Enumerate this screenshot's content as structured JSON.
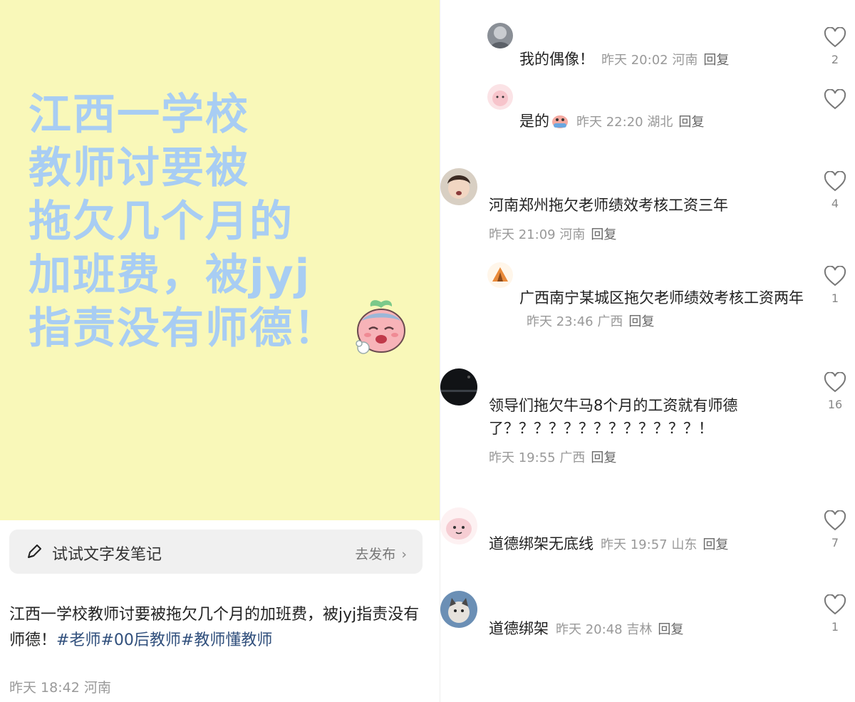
{
  "cover": {
    "lines": [
      "江西一学校",
      "教师讨要被",
      "拖欠几个月的",
      "加班费，被jyj",
      "指责没有师德！"
    ],
    "bg_color": "#f9f8b9",
    "text_color": "#a8cdf3"
  },
  "note_bar": {
    "prompt": "试试文字发笔记",
    "publish": "去发布",
    "icon": "pencil-icon"
  },
  "post": {
    "text": "江西一学校教师讨要被拖欠几个月的加班费，被jyj指责没有师德！",
    "tags": [
      "#老师",
      "#00后教师",
      "#教师懂教师"
    ],
    "meta": "昨天 18:42 河南"
  },
  "comments": [
    {
      "text": "我的偶像！",
      "meta": "昨天 20:02 河南",
      "reply": "回复",
      "likes": "2"
    },
    {
      "text": "是的",
      "meta": "昨天 22:20 湖北",
      "reply": "回复",
      "likes": ""
    },
    {
      "text": "河南郑州拖欠老师绩效考核工资三年",
      "meta": "昨天 21:09 河南",
      "reply": "回复",
      "likes": "4"
    },
    {
      "text": "广西南宁某城区拖欠老师绩效考核工资两年",
      "meta": "昨天 23:46 广西",
      "reply": "回复",
      "likes": "1"
    },
    {
      "text": "领导们拖欠牛马8个月的工资就有师德了？？？？？？？？？？？？？！",
      "meta": "昨天 19:55 广西",
      "reply": "回复",
      "likes": "16"
    },
    {
      "text": "道德绑架无底线",
      "meta": "昨天 19:57 山东",
      "reply": "回复",
      "likes": "7"
    },
    {
      "text": "道德绑架",
      "meta": "昨天 20:48 吉林",
      "reply": "回复",
      "likes": "1"
    }
  ]
}
